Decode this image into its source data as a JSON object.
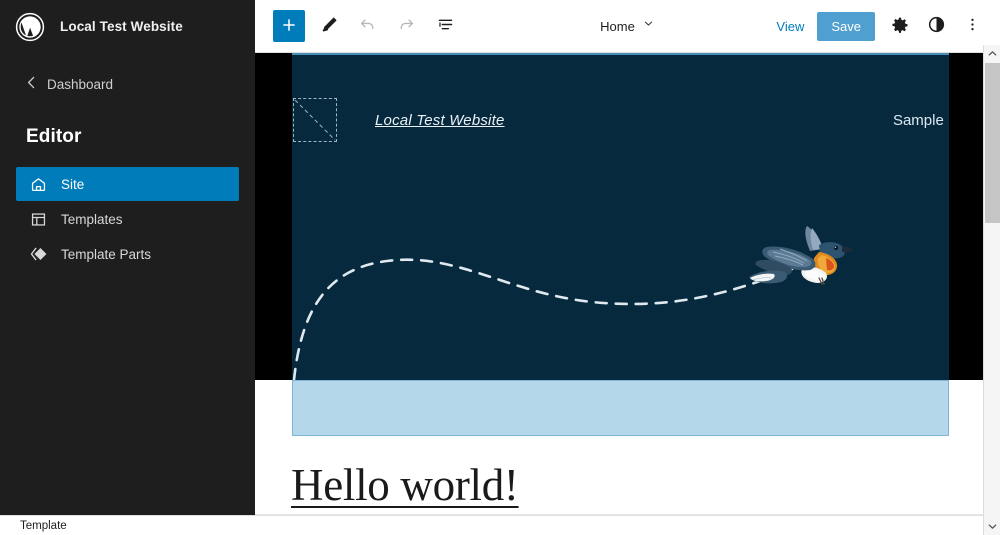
{
  "sidebar": {
    "logo_icon": "wordpress-logo",
    "site_name": "Local Test Website",
    "dashboard_label": "Dashboard",
    "dashboard_icon": "chevron-left-icon",
    "section_heading": "Editor",
    "items": [
      {
        "label": "Site",
        "icon": "home-icon",
        "active": true
      },
      {
        "label": "Templates",
        "icon": "layout-icon",
        "active": false
      },
      {
        "label": "Template Parts",
        "icon": "template-parts-icon",
        "active": false
      }
    ],
    "background_color": "#1e1e1e",
    "active_color": "#007cba"
  },
  "toolbar": {
    "add_block_label": "+",
    "add_block_icon": "plus-icon",
    "add_block_color": "#007cba",
    "edit_tool_icon": "pencil-icon",
    "undo_icon": "undo-arrow-icon",
    "redo_icon": "redo-arrow-icon",
    "list_view_icon": "list-view-icon",
    "document_title": "Home",
    "document_chevron_icon": "chevron-down-icon",
    "view_label": "View",
    "save_label": "Save",
    "save_color": "#4f9fd0",
    "settings_icon": "gear-icon",
    "styles_icon": "contrast-half-circle-icon",
    "options_icon": "more-vertical-dots-icon"
  },
  "canvas": {
    "hero": {
      "background_color": "#06293d",
      "letterbox_color": "#000000",
      "logo_placeholder_icon": "image-placeholder-icon",
      "brand_title": "Local Test Website",
      "nav_link": "Sample Page",
      "bird_icon": "flying-bird-illustration",
      "flight_path_icon": "dashed-curve-path"
    },
    "selected_block": {
      "fill_color": "#b4d7ea",
      "border_color": "#7eb5d6"
    },
    "post": {
      "title": "Hello world!"
    }
  },
  "scrollbar": {
    "up_icon": "chevron-up-icon",
    "down_icon": "chevron-down-icon"
  },
  "statusbar": {
    "label": "Template"
  }
}
